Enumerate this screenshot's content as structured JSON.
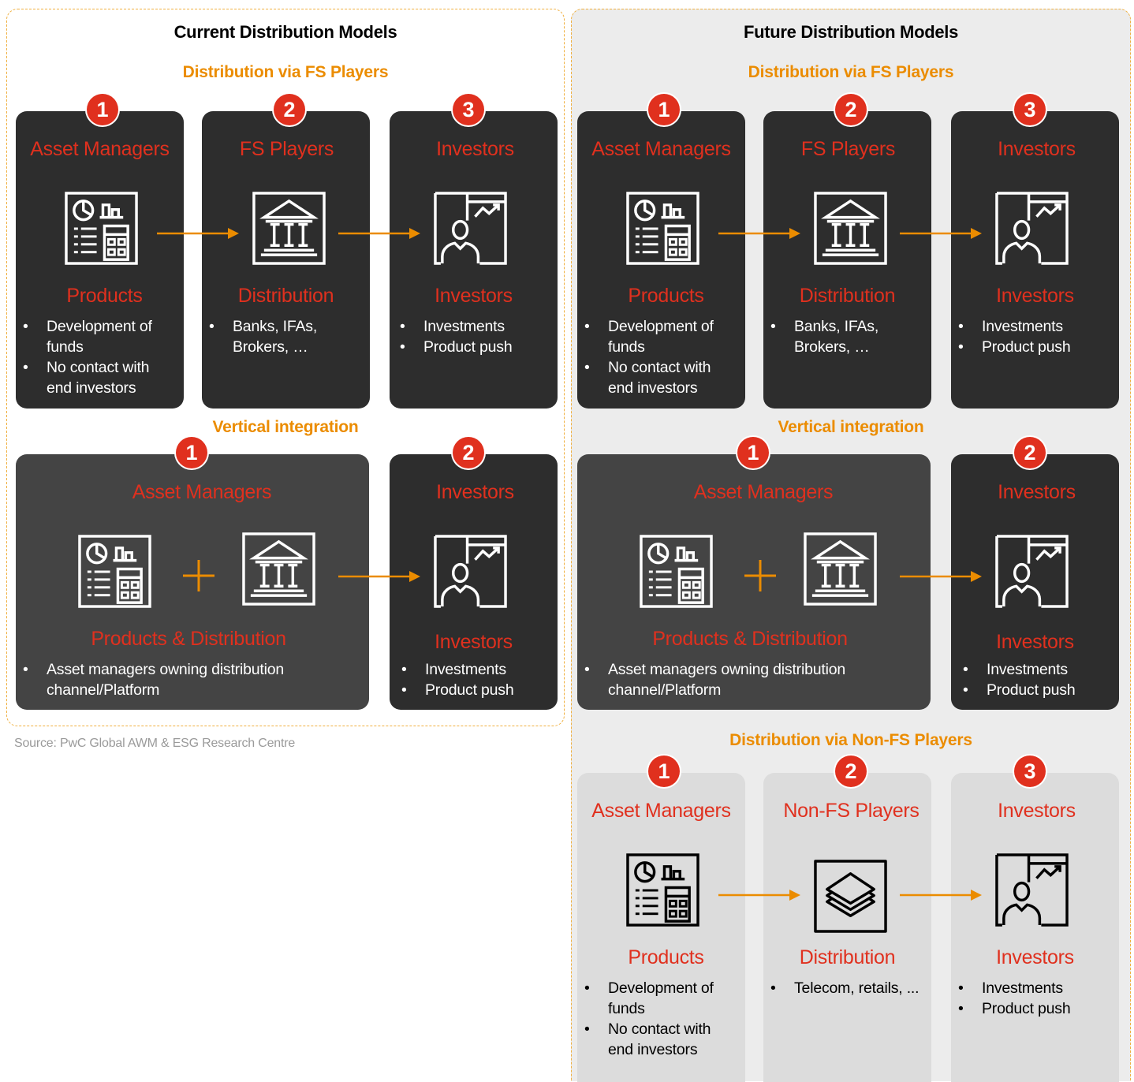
{
  "current": {
    "title": "Current Distribution Models",
    "fs_section": {
      "title": "Distribution via FS Players",
      "cards": [
        {
          "num": "1",
          "title": "Asset Managers",
          "icon": "products-icon",
          "sub": "Products",
          "bullets": [
            "Development of funds",
            "No contact with end investors"
          ]
        },
        {
          "num": "2",
          "title": "FS Players",
          "icon": "bank-icon",
          "sub": "Distribution",
          "bullets": [
            "Banks, IFAs, Brokers, …"
          ]
        },
        {
          "num": "3",
          "title": "Investors",
          "icon": "investor-icon",
          "sub": "Investors",
          "bullets": [
            "Investments",
            "Product push"
          ]
        }
      ]
    },
    "vi_section": {
      "title": "Vertical integration",
      "cards": [
        {
          "num": "1",
          "title": "Asset Managers",
          "sub": "Products & Distribution",
          "bullets": [
            "Asset managers owning distribution channel/Platform"
          ]
        },
        {
          "num": "2",
          "title": "Investors",
          "sub": "Investors",
          "bullets": [
            "Investments",
            "Product push"
          ]
        }
      ]
    }
  },
  "future": {
    "title": "Future Distribution Models",
    "fs_section": {
      "title": "Distribution via FS Players",
      "cards": [
        {
          "num": "1",
          "title": "Asset Managers",
          "sub": "Products",
          "bullets": [
            "Development of funds",
            "No contact with end investors"
          ]
        },
        {
          "num": "2",
          "title": "FS Players",
          "sub": "Distribution",
          "bullets": [
            "Banks, IFAs, Brokers, …"
          ]
        },
        {
          "num": "3",
          "title": "Investors",
          "sub": "Investors",
          "bullets": [
            "Investments",
            "Product push"
          ]
        }
      ]
    },
    "vi_section": {
      "title": "Vertical integration",
      "cards": [
        {
          "num": "1",
          "title": "Asset Managers",
          "sub": "Products & Distribution",
          "bullets": [
            "Asset managers owning distribution channel/Platform"
          ]
        },
        {
          "num": "2",
          "title": "Investors",
          "sub": "Investors",
          "bullets": [
            "Investments",
            "Product push"
          ]
        }
      ]
    },
    "nonfs_section": {
      "title": "Distribution via Non-FS Players",
      "cards": [
        {
          "num": "1",
          "title": "Asset Managers",
          "sub": "Products",
          "bullets": [
            "Development of funds",
            "No contact with end investors"
          ]
        },
        {
          "num": "2",
          "title": "Non-FS Players",
          "sub": "Distribution",
          "bullets": [
            "Telecom, retails, ..."
          ]
        },
        {
          "num": "3",
          "title": "Investors",
          "sub": "Investors",
          "bullets": [
            "Investments",
            "Product push"
          ]
        }
      ]
    }
  },
  "source": "Source: PwC Global AWM & ESG Research Centre",
  "colors": {
    "accent_orange": "#eb8c00",
    "accent_red": "#e0301e",
    "card_dark": "#2d2d2d",
    "card_mid": "#444444",
    "card_light": "#dcdcdc"
  }
}
